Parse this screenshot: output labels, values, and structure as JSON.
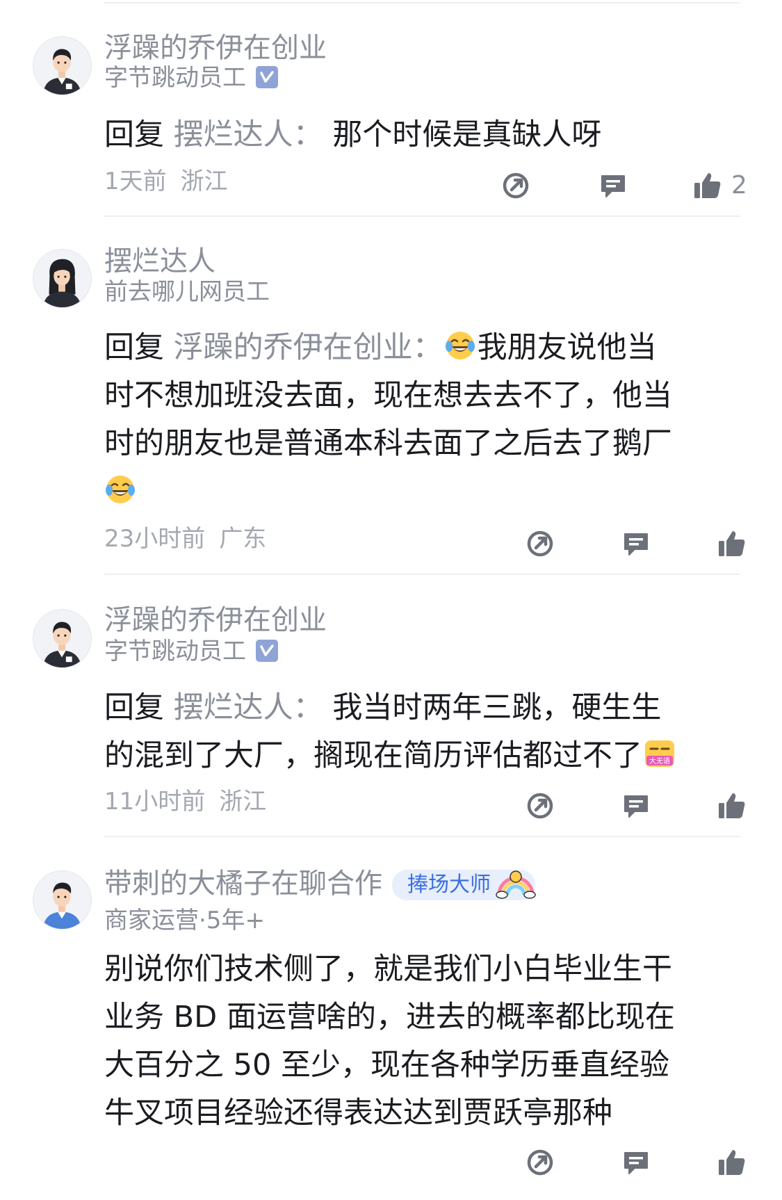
{
  "comments": [
    {
      "author": "浮躁的乔伊在创业",
      "title": "字节跳动员工",
      "reply_prefix": "回复",
      "reply_to": "摆烂达人：",
      "text": "那个时候是真缺人呀",
      "time": "1天前",
      "location": "浙江",
      "likes": "2"
    },
    {
      "author": "摆烂达人",
      "title": "前去哪儿网员工",
      "reply_prefix": "回复",
      "reply_to": "浮躁的乔伊在创业：",
      "text_line1": "我朋友说他当",
      "text_line2": "时不想加班没去面，现在想去去不了，他当",
      "text_line3": "时的朋友也是普通本科去面了之后去了鹅厂",
      "time": "23小时前",
      "location": "广东"
    },
    {
      "author": "浮躁的乔伊在创业",
      "title": "字节跳动员工",
      "reply_prefix": "回复",
      "reply_to": "摆烂达人：",
      "text_line1": "我当时两年三跳，硬生生",
      "text_line2": "的混到了大厂，搁现在简历评估都过不了",
      "emoji_text": "大无语",
      "time": "11小时前",
      "location": "浙江"
    },
    {
      "author": "带刺的大橘子在聊合作",
      "badge": "捧场大师",
      "title": "商家运营·5年+",
      "text_line1": "别说你们技术侧了，就是我们小白毕业生干",
      "text_line2": "业务 BD 面运营啥的，进去的概率都比现在",
      "text_line3": "大百分之 50 至少，现在各种学历垂直经验",
      "text_line4": "牛叉项目经验还得表达达到贾跃亭那种"
    }
  ],
  "icons": {
    "share": "share-icon",
    "comment": "comment-icon",
    "like": "thumbs-up-icon",
    "verified": "verified-icon",
    "emoji_laugh": "tears-of-joy-emoji",
    "emoji_speechless": "speechless-emoji"
  },
  "colors": {
    "secondary_text": "#8a8f99",
    "body_text": "#1b1c21",
    "badge_bg": "#e7eefc",
    "badge_text": "#3a6fe0",
    "verified": "#8fa4d6"
  }
}
